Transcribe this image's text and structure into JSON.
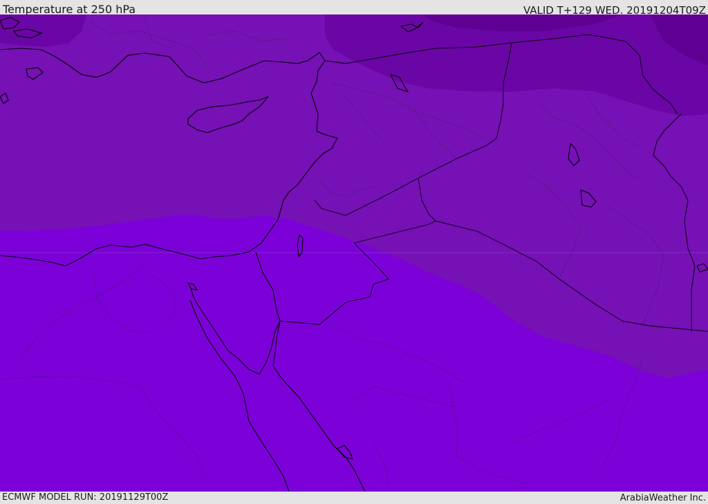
{
  "header": {
    "title": "Temperature at 250 hPa",
    "valid_time": "VALID T+129 WED. 20191204T09Z"
  },
  "footer": {
    "model_run": "ECMWF MODEL RUN: 20191129T00Z",
    "credit": "ArabiaWeather Inc."
  },
  "map": {
    "layer": "temperature-250hpa",
    "colors": {
      "band_coldest": "#5f0092",
      "band_cold": "#7010aa",
      "band_mid": "#7511b5",
      "band_warm": "#7c00d8",
      "coastline": "#000000"
    }
  }
}
